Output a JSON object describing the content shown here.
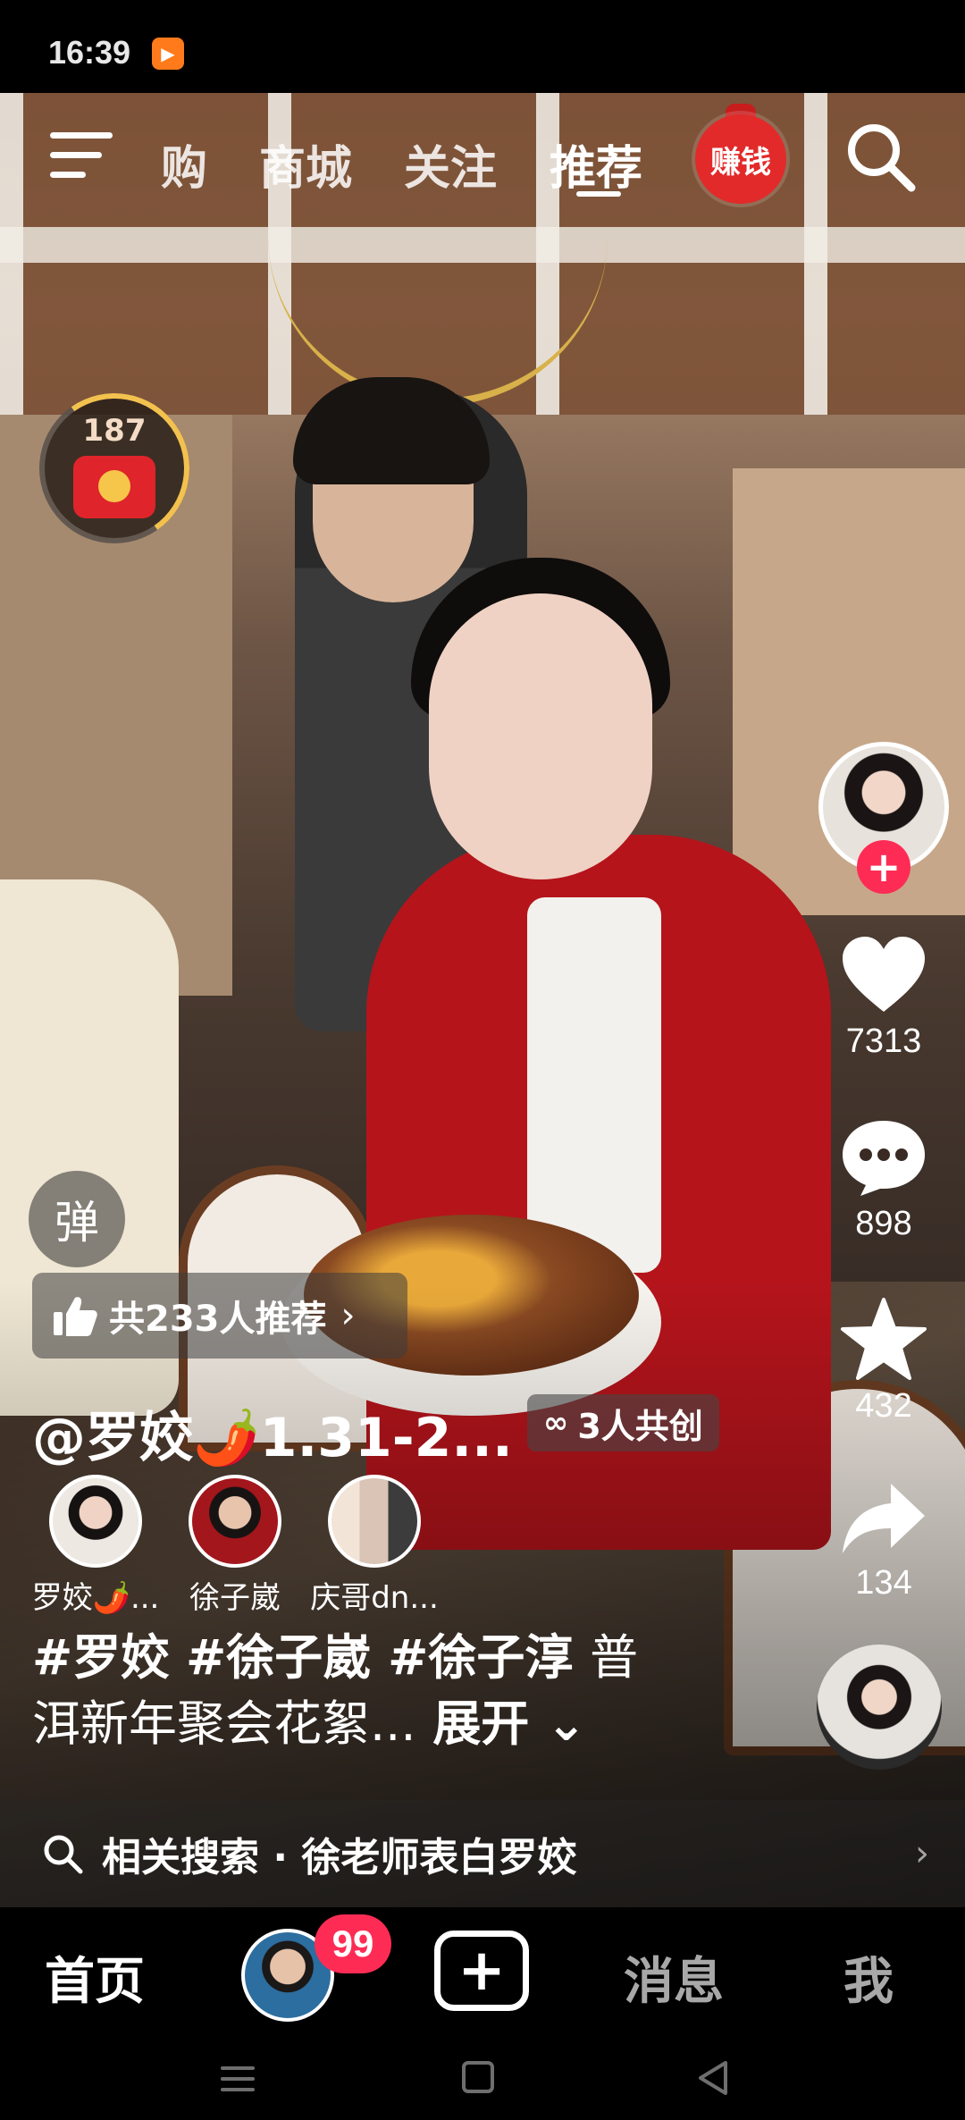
{
  "status_bar": {
    "time": "16:39",
    "app_icon": "video-app-icon"
  },
  "top_nav": {
    "tabs": [
      "购",
      "商城",
      "关注",
      "推荐"
    ],
    "active_tab": "推荐",
    "earn_label": "赚钱"
  },
  "red_packet": {
    "count": "187"
  },
  "right_rail": {
    "like_count": "7313",
    "comment_count": "898",
    "favorite_count": "432",
    "share_count": "134"
  },
  "danmaku_label": "弹",
  "recommend": {
    "text": "共233人推荐",
    "chevron": "›"
  },
  "author": {
    "name": "@罗姣🌶️1.31-2..."
  },
  "cocreate": {
    "icon": "∞",
    "label": "3人共创"
  },
  "creators": [
    {
      "name": "罗姣🌶️..."
    },
    {
      "name": "徐子崴"
    },
    {
      "name": "庆哥dn..."
    }
  ],
  "caption": {
    "tags": "#罗姣 #徐子崴 #徐子淳",
    "text": "普洱新年聚会花絮...",
    "more": "展开"
  },
  "related_search": {
    "label": "相关搜索 · 徐老师表白罗姣",
    "arrow": "›"
  },
  "bottom_nav": {
    "home": "首页",
    "badge": "99",
    "create": "+",
    "messages": "消息",
    "me": "我"
  },
  "colors": {
    "accent": "#fe2c55",
    "earn_red": "#e22a2a",
    "packet_gold": "#f3c14e"
  }
}
